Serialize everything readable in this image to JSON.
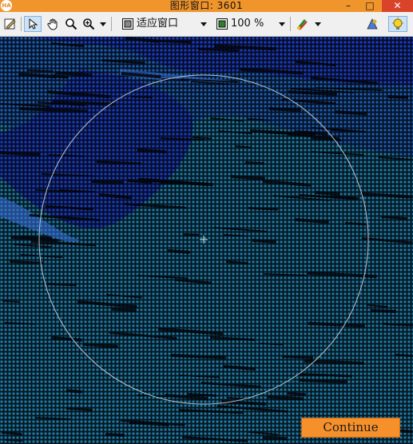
{
  "window": {
    "app_badge": "HA",
    "title": "图形窗口: 3601",
    "minimize": "–",
    "maximize": "□",
    "close": "✕"
  },
  "toolbar": {
    "zoom_fit_label": "适应窗口",
    "zoom_percent_label": "100 %",
    "tools": [
      "edit-settings-icon",
      "pointer-icon",
      "hand-pan-icon",
      "magnifier-icon",
      "zoom-in-icon",
      "zoom-fit-icon",
      "zoom-percent-icon",
      "color-paint-icon",
      "3d-view-icon",
      "lightbulb-icon"
    ]
  },
  "canvas": {
    "content": "point-cloud",
    "roi_shape": "circle",
    "crosshair": "center-cross"
  },
  "continue_button": {
    "label": "Continue"
  },
  "colors": {
    "titlebar": "#f0952c",
    "close_button": "#d9432a",
    "continue_button": "#f5902a",
    "points_blue": "#1a3fc4",
    "points_teal": "#1b7fa8",
    "roi_circle": "#b8c2cc"
  }
}
